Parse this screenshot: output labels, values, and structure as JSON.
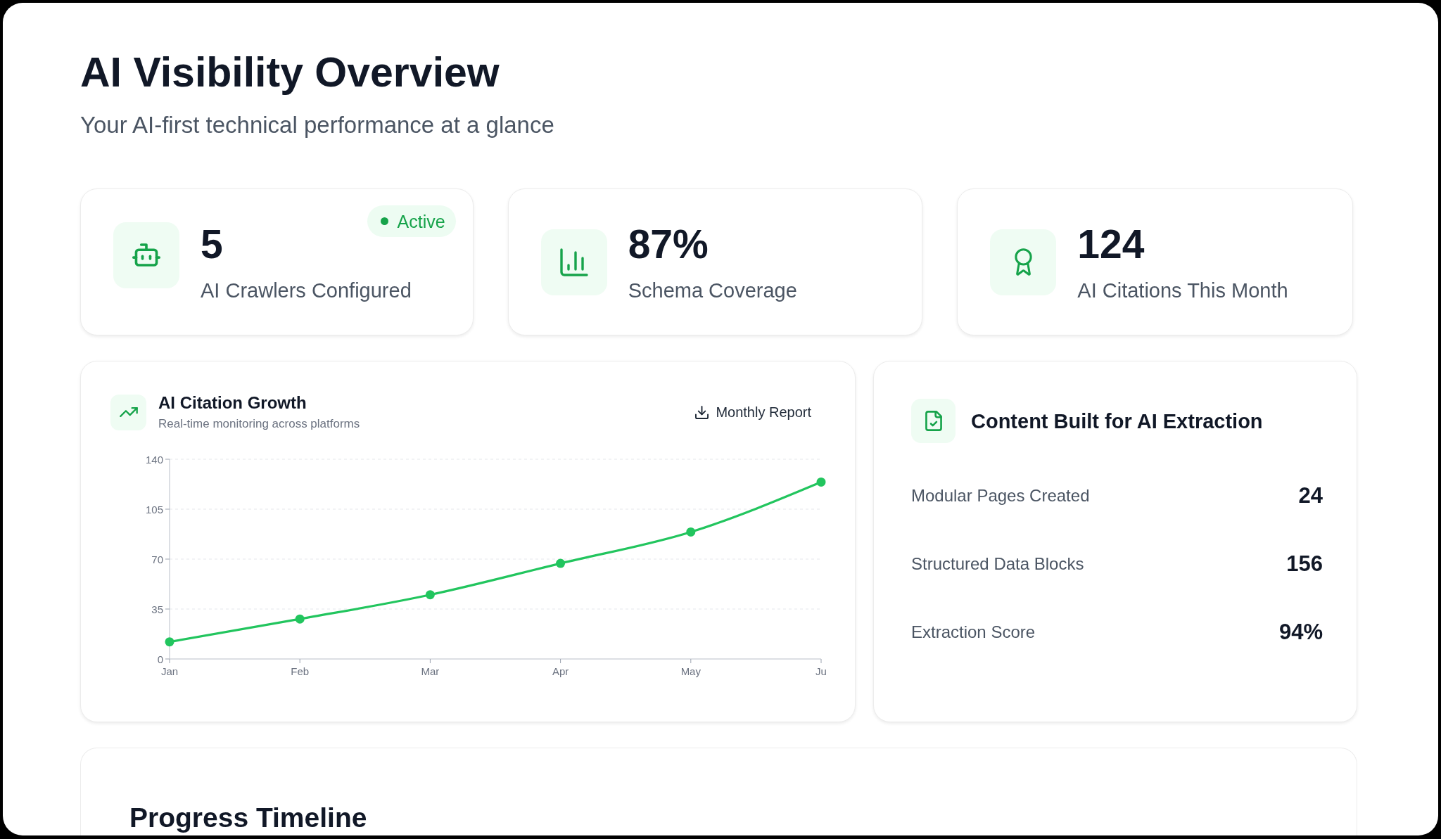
{
  "header": {
    "title": "AI Visibility Overview",
    "subtitle": "Your AI-first technical performance at a glance"
  },
  "stat_cards": [
    {
      "value": "5",
      "label": "AI Crawlers Configured",
      "badge": {
        "label": "Active"
      }
    },
    {
      "value": "87%",
      "label": "Schema Coverage"
    },
    {
      "value": "124",
      "label": "AI Citations This Month"
    }
  ],
  "growth_chart": {
    "title": "AI Citation Growth",
    "subtitle": "Real-time monitoring across platforms",
    "action": {
      "label": "Monthly Report"
    },
    "chart_data": {
      "type": "line",
      "categories": [
        "Jan",
        "Feb",
        "Mar",
        "Apr",
        "May",
        "Ju"
      ],
      "series": [
        {
          "color": "#22c55e",
          "marker": true,
          "values": [
            12,
            28,
            45,
            67,
            89,
            124
          ]
        }
      ],
      "ylim": [
        0,
        140
      ],
      "yticks": [
        0,
        35,
        70,
        105,
        140
      ],
      "grid": true
    }
  },
  "extraction_panel": {
    "title": "Content Built for AI Extraction",
    "rows": [
      {
        "label": "Modular Pages Created",
        "value": "24"
      },
      {
        "label": "Structured Data Blocks",
        "value": "156"
      },
      {
        "label": "Extraction Score",
        "value": "94%"
      }
    ]
  },
  "timeline": {
    "title": "Progress Timeline"
  }
}
